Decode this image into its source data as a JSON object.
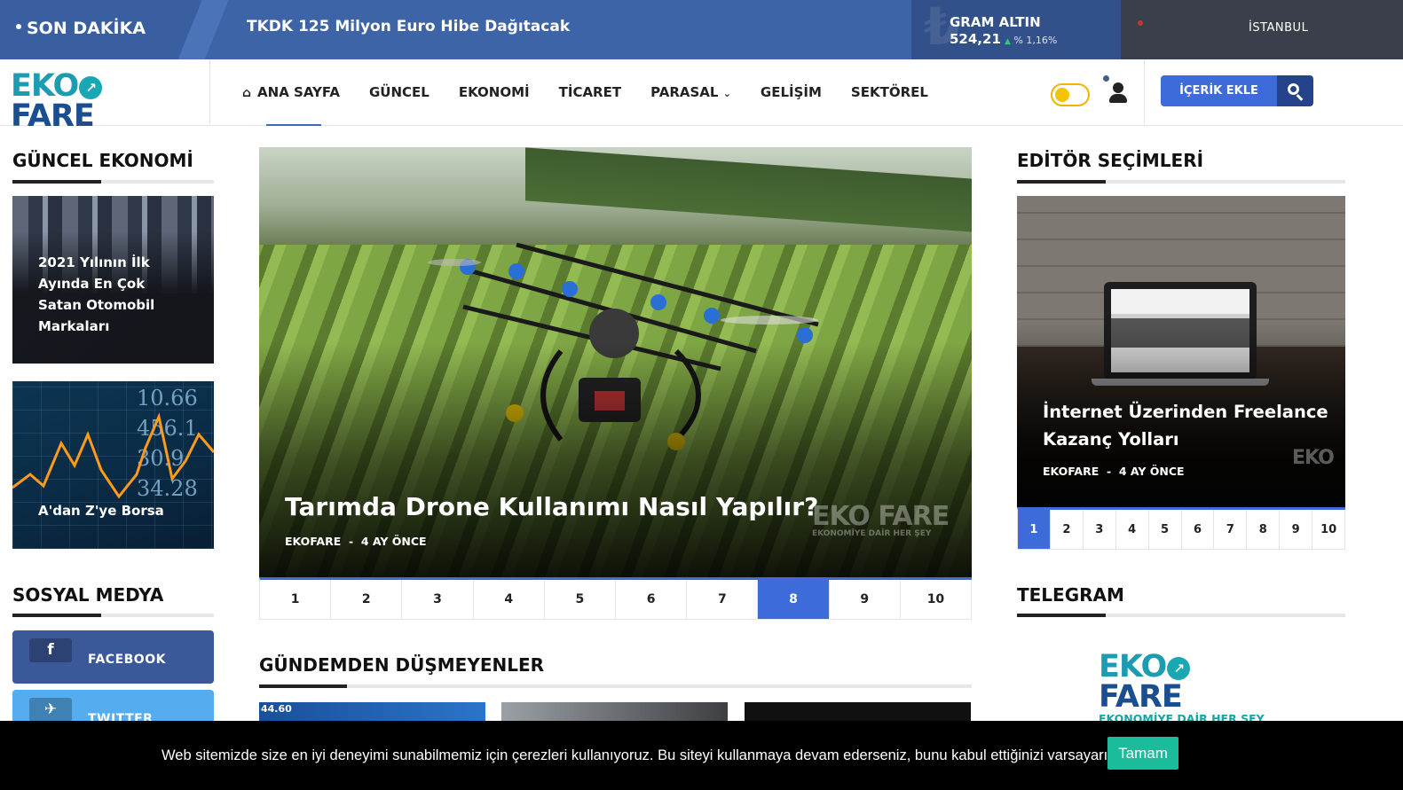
{
  "topbar": {
    "breaking_label": "SON DAKİKA",
    "breaking_headline": "TKDK 125 Milyon Euro Hibe Dağıtacak",
    "gold": {
      "label": "GRAM ALTIN",
      "value": "524,21",
      "change": "% 1,16%",
      "currency_icon": "lira-icon"
    },
    "weather": {
      "city": "İSTANBUL"
    }
  },
  "header": {
    "logo": {
      "part1": "EKO",
      "part2": "FARE",
      "tagline": "EKONOMİYE DAİR HER ŞEY"
    },
    "nav": [
      {
        "label": "ANA SAYFA",
        "icon": "home-icon"
      },
      {
        "label": "GÜNCEL"
      },
      {
        "label": "EKONOMİ"
      },
      {
        "label": "TİCARET"
      },
      {
        "label": "PARASAL",
        "icon": "chevron-down-icon"
      },
      {
        "label": "GELİŞİM"
      },
      {
        "label": "SEKTÖREL"
      }
    ],
    "add_content": "İÇERİK EKLE"
  },
  "left": {
    "current_title": "GÜNCEL EKONOMİ",
    "cards": [
      {
        "title": "2021 Yılının İlk Ayında En Çok Satan Otomobil Markaları"
      },
      {
        "title": "A'dan Z'ye Borsa"
      }
    ],
    "social_title": "SOSYAL MEDYA",
    "social": [
      {
        "label": "FACEBOOK",
        "icon": "f",
        "color": "#3b5998"
      },
      {
        "label": "TWITTER",
        "icon": "t",
        "color": "#55acee"
      }
    ]
  },
  "center": {
    "slider": {
      "title": "Tarımda Drone Kullanımı Nasıl Yapılır?",
      "author": "EKOFARE",
      "time": "4 AY ÖNCE",
      "pages": [
        "1",
        "2",
        "3",
        "4",
        "5",
        "6",
        "7",
        "8",
        "9",
        "10"
      ],
      "active_page": "8"
    },
    "section_title": "GÜNDEMDEN DÜŞMEYENLER",
    "thumb_text": "44.60"
  },
  "right": {
    "editor_title": "EDİTÖR SEÇİMLERİ",
    "card": {
      "title": "İnternet Üzerinden Freelance Kazanç Yolları",
      "author": "EKOFARE",
      "time": "4 AY ÖNCE"
    },
    "pages": [
      "1",
      "2",
      "3",
      "4",
      "5",
      "6",
      "7",
      "8",
      "9",
      "10"
    ],
    "active_page": "1",
    "telegram_title": "TELEGRAM"
  },
  "cookie": {
    "text": "Web sitemizde size en iyi deneyimi sunabilmemiz için çerezleri kullanıyoruz. Bu siteyi kullanmaya devam ederseniz, bunu kabul ettiğinizi varsayarız.",
    "button": "Tamam"
  },
  "colors": {
    "accent": "#3d6bd9",
    "topbar": "#3d64a6",
    "cookie_button": "#1abc9c"
  }
}
